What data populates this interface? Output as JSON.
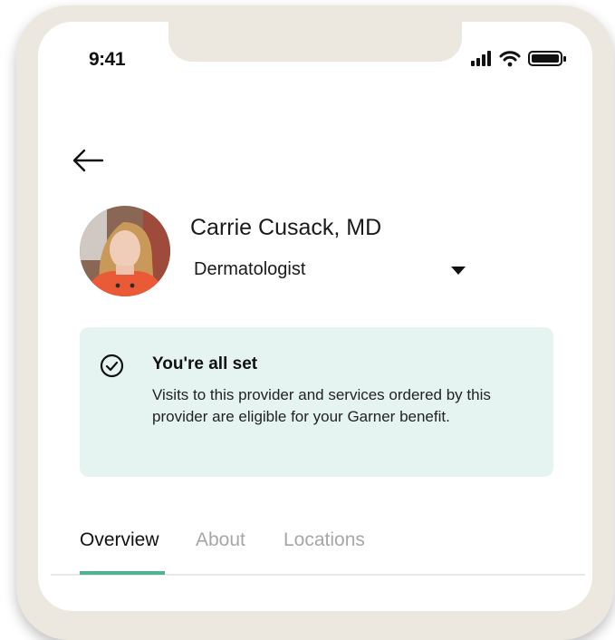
{
  "status_bar": {
    "time": "9:41",
    "icons": [
      "signal-icon",
      "wifi-icon",
      "battery-icon"
    ]
  },
  "navigation": {
    "back_icon": "arrow-left-icon"
  },
  "provider": {
    "name": "Carrie Cusack, MD",
    "specialty": "Dermatologist",
    "specialty_dropdown_icon": "caret-down-icon"
  },
  "eligibility_alert": {
    "icon": "check-circle-icon",
    "title": "You're all set",
    "message": "Visits to this provider and services ordered by this provider are eligible for your Garner benefit.",
    "background_color": "#e6f4f1"
  },
  "tabs": [
    {
      "label": "Overview",
      "active": true
    },
    {
      "label": "About",
      "active": false
    },
    {
      "label": "Locations",
      "active": false
    }
  ],
  "colors": {
    "frame": "#ece8df",
    "accent": "#52b294",
    "inactive_tab": "#a7a7a7"
  }
}
